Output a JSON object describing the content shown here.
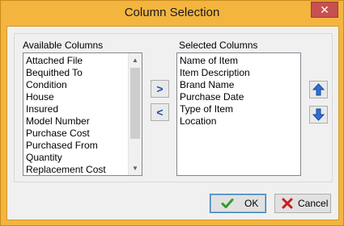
{
  "window": {
    "title": "Column Selection",
    "close_label": "✕"
  },
  "available": {
    "label": "Available Columns",
    "items": [
      "Attached File",
      "Bequithed To",
      "Condition",
      "House",
      "Insured",
      "Model Number",
      "Purchase Cost",
      "Purchased From",
      "Quantity",
      "Replacement Cost"
    ]
  },
  "selected": {
    "label": "Selected Columns",
    "items": [
      "Name of Item",
      "Item Description",
      "Brand Name",
      "Purchase Date",
      "Type of Item",
      "Location"
    ]
  },
  "transfer": {
    "add_label": ">",
    "remove_label": "<"
  },
  "buttons": {
    "ok_label": "OK",
    "cancel_label": "Cancel"
  },
  "colors": {
    "title_bar": "#f4b53f",
    "close": "#c75050",
    "accent_blue": "#1f4fa6",
    "ok_check": "#2e9e2e",
    "cancel_x": "#c81e1e"
  }
}
